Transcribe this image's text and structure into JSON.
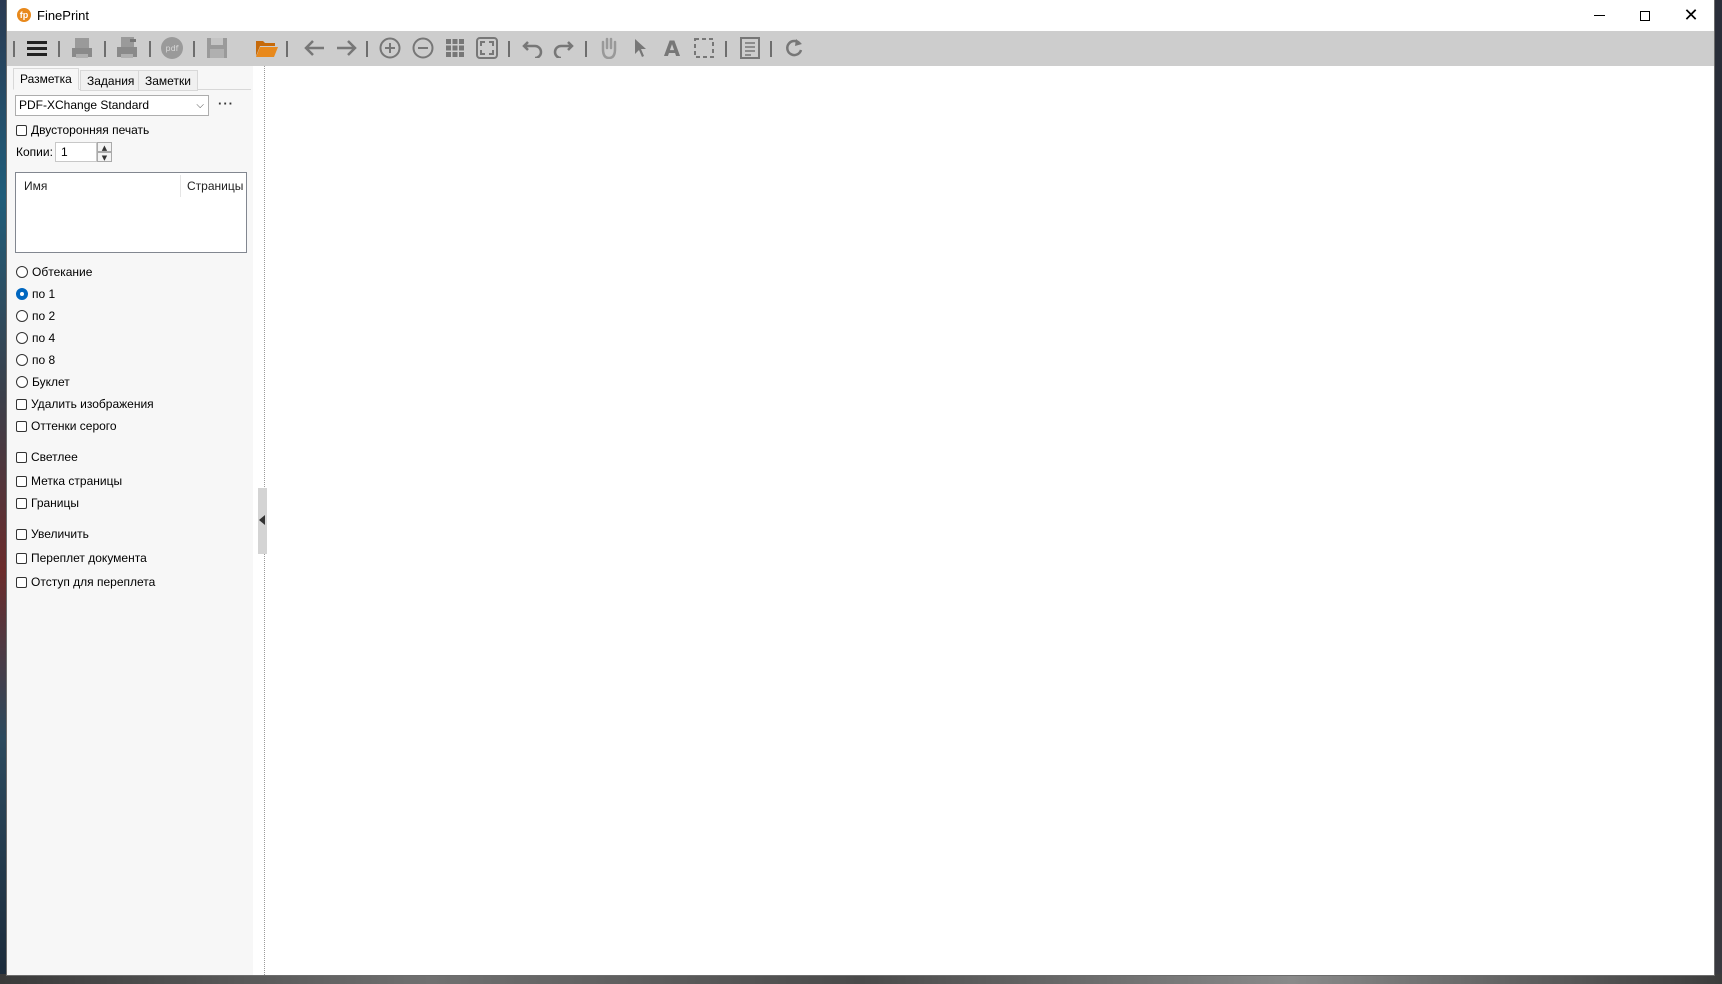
{
  "window": {
    "title": "FinePrint"
  },
  "tabs": [
    "Разметка",
    "Задания",
    "Заметки"
  ],
  "printer": {
    "selected": "PDF-XChange Standard"
  },
  "duplex": {
    "label": "Двусторонняя печать",
    "checked": false
  },
  "copies": {
    "label": "Копии:",
    "value": "1"
  },
  "jobs_table": {
    "columns": [
      "Имя",
      "Страницы"
    ],
    "rows": []
  },
  "layout_options": [
    {
      "label": "Обтекание",
      "selected": false
    },
    {
      "label": "по 1",
      "selected": true
    },
    {
      "label": "по 2",
      "selected": false
    },
    {
      "label": "по 4",
      "selected": false
    },
    {
      "label": "по 8",
      "selected": false
    },
    {
      "label": "Буклет",
      "selected": false
    }
  ],
  "options": [
    {
      "label": "Удалить изображения",
      "checked": false
    },
    {
      "label": "Оттенки серого",
      "checked": false
    },
    {
      "label": "Светлее",
      "checked": false
    },
    {
      "label": "Метка страницы",
      "checked": false
    },
    {
      "label": "Границы",
      "checked": false
    },
    {
      "label": "Увеличить",
      "checked": false
    },
    {
      "label": "Переплет документа",
      "checked": false
    },
    {
      "label": "Отступ для переплета",
      "checked": false
    }
  ],
  "toolbar_icons": [
    "menu-icon",
    "print-icon",
    "print-setup-icon",
    "pdf-icon",
    "save-icon",
    "open-folder-icon",
    "back-arrow-icon",
    "forward-arrow-icon",
    "zoom-in-icon",
    "zoom-out-icon",
    "grid-view-icon",
    "fit-page-icon",
    "undo-icon",
    "redo-icon",
    "hand-tool-icon",
    "pointer-icon",
    "text-tool-icon",
    "select-region-icon",
    "notes-icon",
    "refresh-icon"
  ],
  "colors": {
    "accent": "#0067c0",
    "folder": "#e8891c",
    "toolbar": "#cdcdcd"
  }
}
